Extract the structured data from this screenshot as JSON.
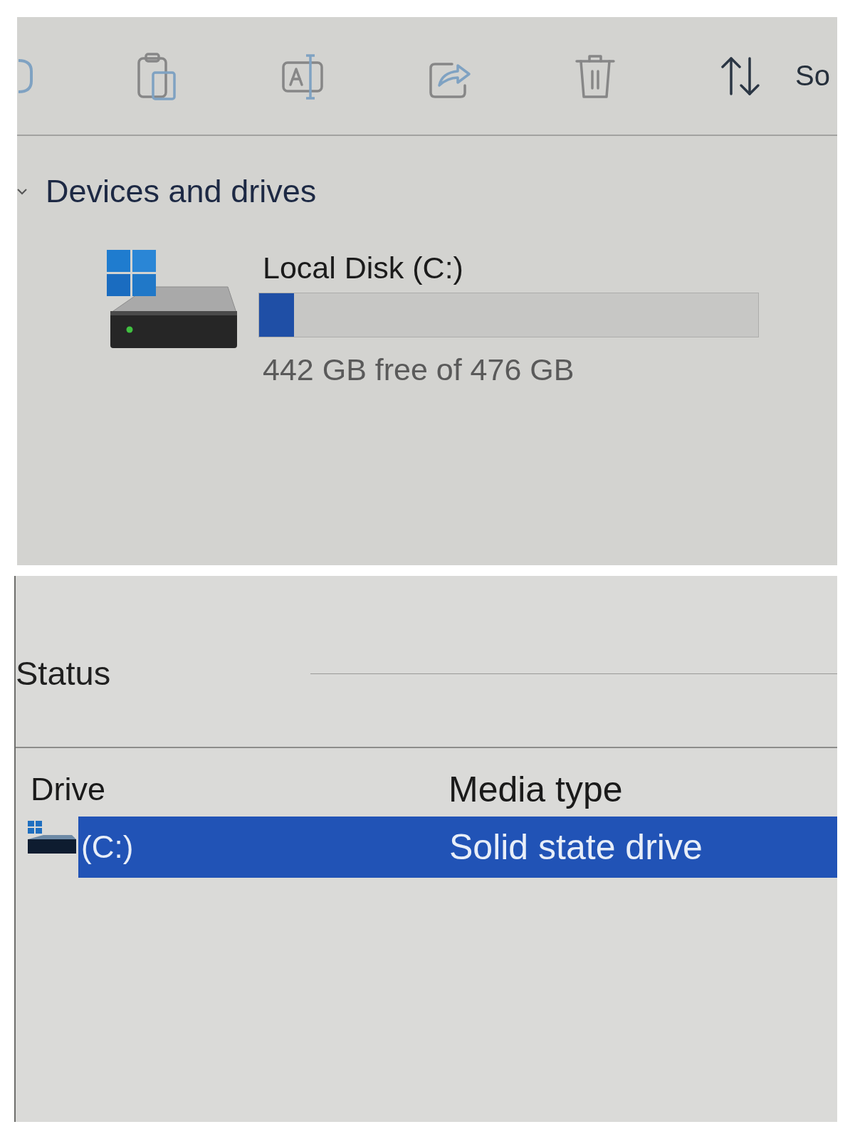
{
  "toolbar": {
    "buttons": [
      {
        "kind": "partial",
        "disabled": true
      },
      {
        "kind": "paste",
        "disabled": true
      },
      {
        "kind": "rename",
        "disabled": true
      },
      {
        "kind": "share",
        "disabled": true
      },
      {
        "kind": "delete",
        "disabled": true
      },
      {
        "kind": "sort",
        "label": "So",
        "disabled": false
      }
    ]
  },
  "devices": {
    "title": "Devices and drives",
    "expanded": true,
    "drives": [
      {
        "name": "Local Disk (C:)",
        "level": 0.07,
        "space": "442 GB free of 476 GB"
      }
    ]
  },
  "status": {
    "label": "Status"
  },
  "table": {
    "columns": [
      "Drive",
      "Media type"
    ],
    "rows": [
      {
        "drive": "(C:)",
        "media_type": "Solid state drive",
        "selected": true
      }
    ]
  }
}
